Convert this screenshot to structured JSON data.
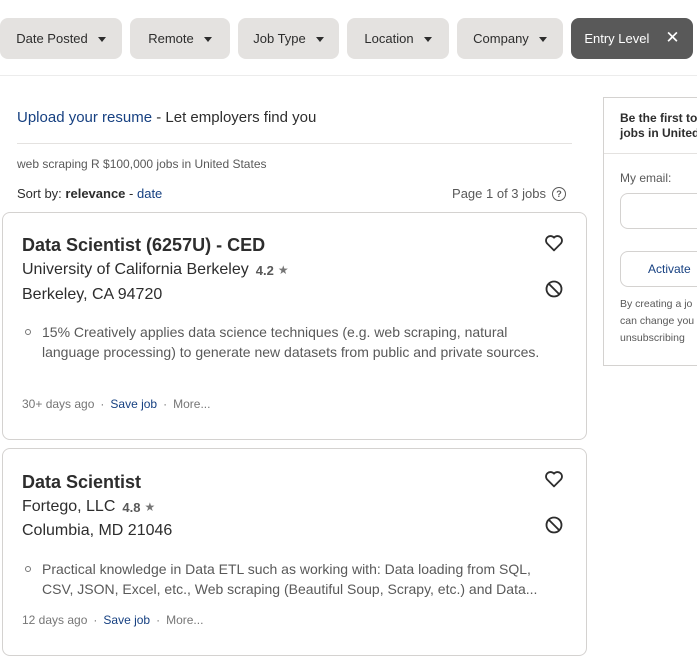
{
  "filters": [
    {
      "label": "Date Posted"
    },
    {
      "label": "Remote"
    },
    {
      "label": "Job Type"
    },
    {
      "label": "Location"
    },
    {
      "label": "Company"
    },
    {
      "label": "Entry Level",
      "active": true
    }
  ],
  "upload": {
    "link": "Upload your resume",
    "rest": " - Let employers find you"
  },
  "search_meta": "web scraping R $100,000 jobs in United States",
  "sort": {
    "prefix": "Sort by: ",
    "active": "relevance",
    "sep": " - ",
    "other": "date"
  },
  "page_info": "Page 1 of 3 jobs",
  "jobs": [
    {
      "title": "Data Scientist (6257U) - CED",
      "company": "University of California Berkeley",
      "rating": "4.2",
      "location": "Berkeley, CA 94720",
      "snippet": "15% Creatively applies data science techniques (e.g. web scraping, natural language processing) to generate new datasets from public and private sources.",
      "posted": "30+ days ago",
      "save": "Save job",
      "more": "More..."
    },
    {
      "title": "Data Scientist",
      "company": "Fortego, LLC",
      "rating": "4.8",
      "location": "Columbia, MD 21046",
      "snippet": "Practical knowledge in Data ETL such as working with: Data loading from SQL, CSV, JSON, Excel, etc., Web scraping (Beautiful Soup, Scrapy, etc.) and Data...",
      "posted": "12 days ago",
      "save": "Save job",
      "more": "More..."
    }
  ],
  "alert": {
    "heading_line1": "Be the first to",
    "heading_line2": "jobs in United",
    "email_label": "My email:",
    "email_value": "",
    "activate": "Activate",
    "disc1": "By creating a jo",
    "disc2": "can change you",
    "disc3": "unsubscribing"
  },
  "colors": {
    "link": "#164081",
    "active_filter_bg": "#595959",
    "filter_bg": "#e4e2e0",
    "text": "#2d2d2d"
  }
}
